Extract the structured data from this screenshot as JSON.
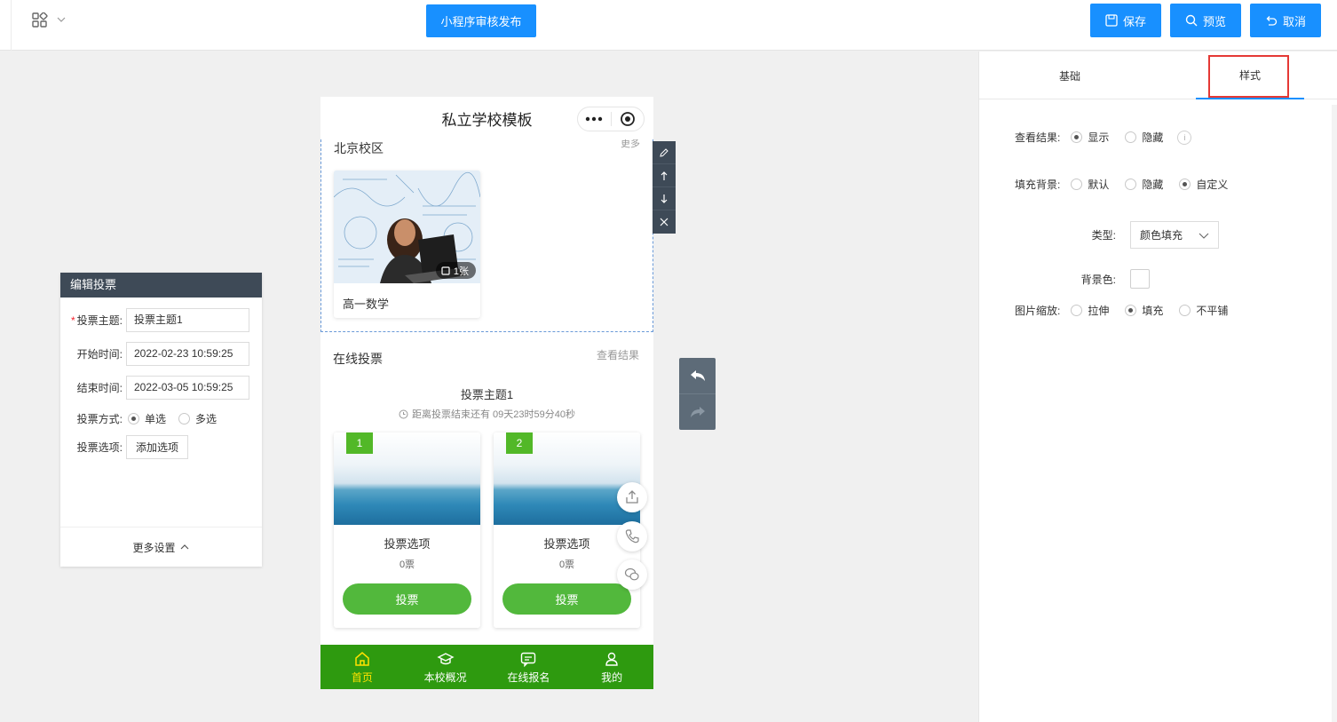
{
  "header": {
    "publish_label": "小程序审核发布",
    "save_label": "保存",
    "preview_label": "预览",
    "cancel_label": "取消"
  },
  "edit_panel": {
    "title": "编辑投票",
    "fields": {
      "subject_label": "投票主题:",
      "subject_value": "投票主题1",
      "start_label": "开始时间:",
      "start_value": "2022-02-23 10:59:25",
      "end_label": "结束时间:",
      "end_value": "2022-03-05 10:59:25",
      "mode_label": "投票方式:",
      "mode_single": "单选",
      "mode_multi": "多选",
      "options_label": "投票选项:",
      "add_option": "添加选项"
    },
    "more_label": "更多设置"
  },
  "phone": {
    "title": "私立学校模板",
    "section1": {
      "title": "北京校区",
      "more": "更多",
      "card_caption": "高一数学",
      "card_badge": "1张"
    },
    "section2": {
      "title": "在线投票",
      "more": "查看结果",
      "vote_title": "投票主题1",
      "countdown": "距离投票结束还有 09天23时59分40秒",
      "options": [
        {
          "num": "1",
          "label": "投票选项",
          "votes": "0票",
          "button": "投票"
        },
        {
          "num": "2",
          "label": "投票选项",
          "votes": "0票",
          "button": "投票"
        }
      ]
    },
    "tabbar": [
      {
        "label": "首页",
        "active": true
      },
      {
        "label": "本校概况",
        "active": false
      },
      {
        "label": "在线报名",
        "active": false
      },
      {
        "label": "我的",
        "active": false
      }
    ]
  },
  "right_panel": {
    "tabs": [
      "基础",
      "样式"
    ],
    "view_result": {
      "label": "查看结果:",
      "options": [
        "显示",
        "隐藏"
      ],
      "selected": "显示"
    },
    "fill_bg": {
      "label": "填充背景:",
      "options": [
        "默认",
        "隐藏",
        "自定义"
      ],
      "selected": "自定义"
    },
    "type": {
      "label": "类型:",
      "value": "颜色填充"
    },
    "bg_color": {
      "label": "背景色:"
    },
    "img_scale": {
      "label": "图片缩放:",
      "options": [
        "拉伸",
        "填充",
        "不平铺"
      ],
      "selected": "填充"
    }
  },
  "colors": {
    "accent": "#1890ff",
    "tabbar": "#2e9a0f",
    "vote_button": "#52b83c",
    "active_tab_text": "#ffe100",
    "highlight": "#e53935"
  }
}
